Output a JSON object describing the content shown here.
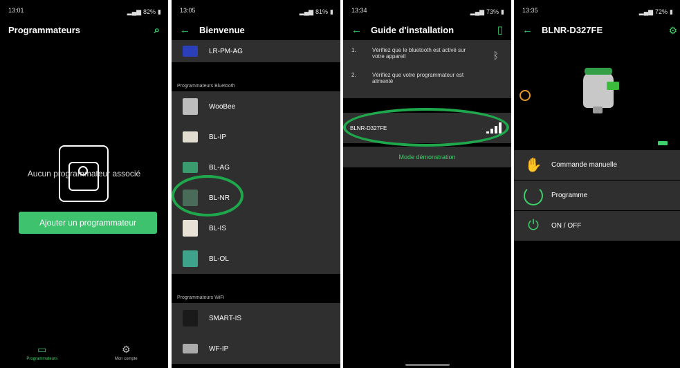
{
  "screen1": {
    "status": {
      "time": "13:01",
      "battery": "82%"
    },
    "header": {
      "title": "Programmateurs"
    },
    "empty_text": "Aucun programmateur associé",
    "add_button": "Ajouter un programmateur",
    "nav": [
      {
        "label": "Programmateurs"
      },
      {
        "label": "Mon compte"
      }
    ]
  },
  "screen2": {
    "status": {
      "time": "13:05",
      "battery": "81%"
    },
    "header": {
      "title": "Bienvenue"
    },
    "top_item": "LR-PM-AG",
    "section_bluetooth": "Programmateurs Bluetooth",
    "bluetooth_items": [
      "WooBee",
      "BL-IP",
      "BL-AG",
      "BL-NR",
      "BL-IS",
      "BL-OL"
    ],
    "section_wifi": "Programmateurs WiFi",
    "wifi_items": [
      "SMART-IS",
      "WF-IP"
    ]
  },
  "screen3": {
    "status": {
      "time": "13:34",
      "battery": "73%"
    },
    "header": {
      "title": "Guide d'installation"
    },
    "steps": [
      {
        "num": "1.",
        "text": "Vérifiez que le bluetooth est activé sur votre appareil"
      },
      {
        "num": "2.",
        "text": "Vérifiez que votre programmateur est alimenté"
      }
    ],
    "device": "BLNR-D327FE",
    "demo_mode": "Mode démonstration"
  },
  "screen4": {
    "status": {
      "time": "13:35",
      "battery": "72%"
    },
    "header": {
      "title": "BLNR-D327FE"
    },
    "menu": [
      {
        "label": "Commande manuelle",
        "icon": "hand-icon"
      },
      {
        "label": "Programme",
        "icon": "cycle-icon"
      },
      {
        "label": "ON / OFF",
        "icon": "power-icon"
      }
    ]
  },
  "colors": {
    "accent": "#3dd06b",
    "button": "#3ec26d",
    "highlight_circle": "#1ea84b",
    "clock": "#e09a23"
  }
}
